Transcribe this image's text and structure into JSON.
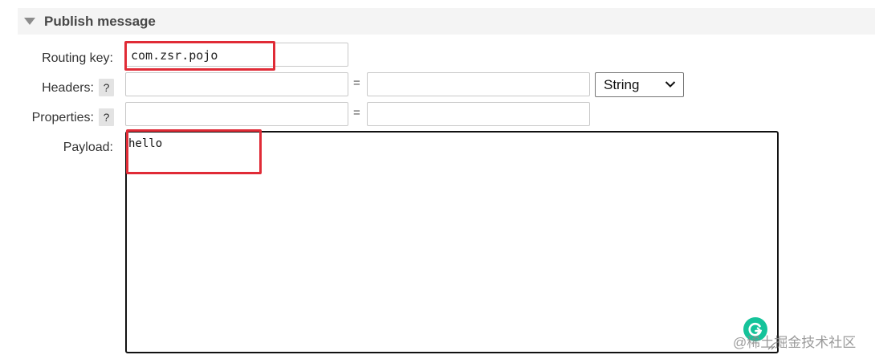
{
  "section": {
    "title": "Publish message"
  },
  "routing_key": {
    "label": "Routing key:",
    "value": "com.zsr.pojo"
  },
  "headers": {
    "label": "Headers:",
    "help": "?",
    "equals": "=",
    "type_selected": "String"
  },
  "properties": {
    "label": "Properties:",
    "help": "?",
    "equals": "="
  },
  "payload": {
    "label": "Payload:",
    "value": "hello"
  },
  "watermark": {
    "text": "@稀土掘金技术社区"
  },
  "colors": {
    "highlight": "#e02b36",
    "header_bg": "#f4f4f4",
    "grammarly": "#15c39a"
  },
  "icons": [
    "collapse-triangle-icon",
    "chevron-down-icon",
    "resize-handle-icon",
    "grammarly-icon"
  ]
}
